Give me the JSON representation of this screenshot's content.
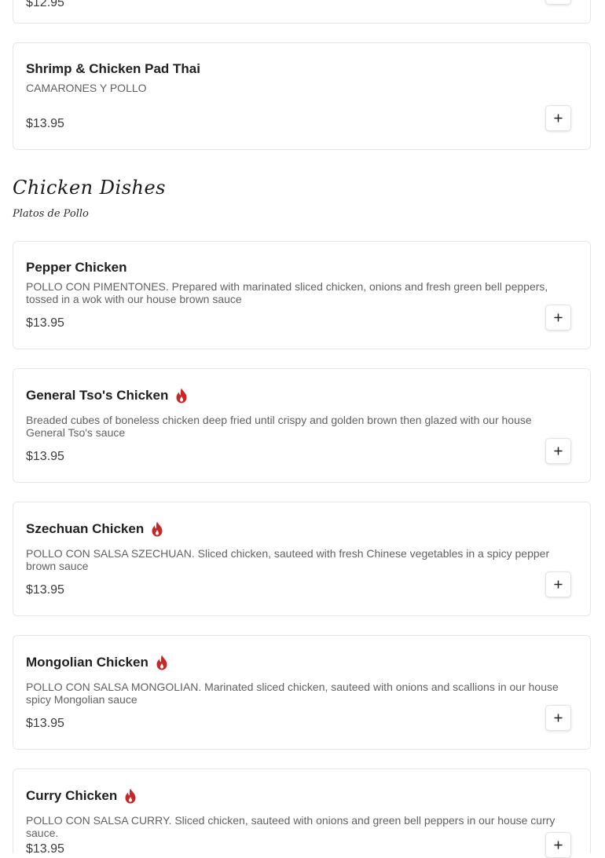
{
  "prev_item": {
    "price": "$12.95"
  },
  "pad_thai": {
    "name": "Shrimp & Chicken Pad Thai",
    "desc": "CAMARONES Y POLLO",
    "price": "$13.95"
  },
  "section": {
    "title": "Chicken Dishes",
    "subtitle": "Platos de Pollo"
  },
  "items": [
    {
      "name": "Pepper Chicken",
      "spicy": false,
      "desc": "POLLO CON PIMENTONES. Prepared with marinated sliced chicken, onions and fresh green bell peppers, tossed in a wok with our house brown sauce",
      "price": "$13.95"
    },
    {
      "name": "General Tso's Chicken",
      "spicy": true,
      "desc": "Breaded cubes of boneless chicken deep fried until crispy and golden brown then glazed with our house General Tso's sauce",
      "price": "$13.95"
    },
    {
      "name": "Szechuan Chicken",
      "spicy": true,
      "desc": "POLLO CON SALSA SZECHUAN. Sliced chicken, sauteed with fresh Chinese vegetables in a spicy pepper brown sauce",
      "price": "$13.95"
    },
    {
      "name": "Mongolian Chicken",
      "spicy": true,
      "desc": "POLLO CON SALSA MONGOLIAN. Marinated sliced chicken, sauteed with onions and scallions in our house spicy Mongolian sauce",
      "price": "$13.95"
    },
    {
      "name": "Curry Chicken",
      "spicy": true,
      "desc": "POLLO CON SALSA CURRY. Sliced chicken, sauteed with onions and green bell peppers in our house curry sauce.",
      "price": "$13.95"
    }
  ],
  "icons": {
    "add": "plus-icon",
    "spicy": "flame-icon"
  },
  "colors": {
    "spicy": "#c62828",
    "border": "#e6e6e6",
    "desc": "#616161"
  }
}
